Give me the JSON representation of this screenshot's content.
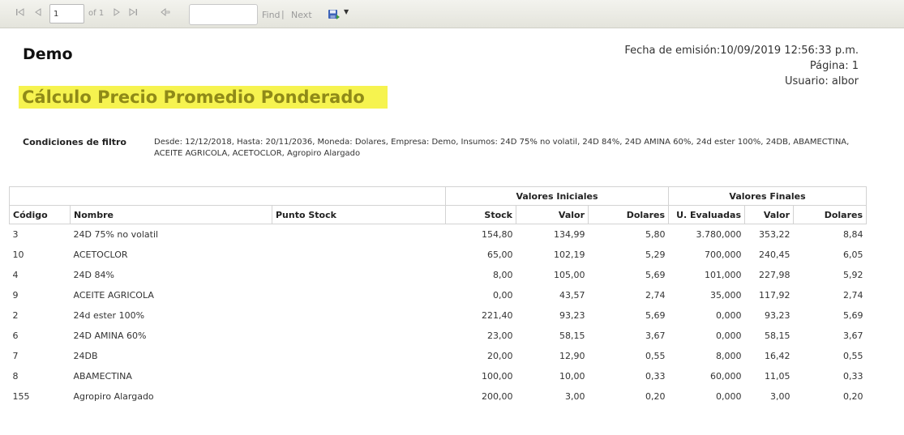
{
  "toolbar": {
    "page_value": "1",
    "of_label": "of 1",
    "find_label": "Find",
    "find_separator": "|",
    "next_label": "Next",
    "icons": [
      "first-page-icon",
      "prev-page-icon",
      "next-page-icon",
      "last-page-icon",
      "back-icon",
      "export-save-icon",
      "dropdown-arrow-icon"
    ]
  },
  "header": {
    "company": "Demo",
    "issue_date": "Fecha de emisión:10/09/2019 12:56:33 p.m.",
    "page": "Página: 1",
    "user": "Usuario: albor",
    "report_title": "Cálculo Precio Promedio Ponderado"
  },
  "filters": {
    "label": "Condiciones de filtro",
    "text": "Desde: 12/12/2018, Hasta: 20/11/2036, Moneda: Dolares, Empresa: Demo, Insumos: 24D 75% no volatil, 24D 84%, 24D AMINA 60%, 24d ester 100%, 24DB, ABAMECTINA, ACEITE AGRICOLA, ACETOCLOR, Agropiro Alargado"
  },
  "table": {
    "group_initial": "Valores Iniciales",
    "group_final": "Valores Finales",
    "columns": [
      "Código",
      "Nombre",
      "Punto Stock",
      "Stock",
      "Valor",
      "Dolares",
      "U. Evaluadas",
      "Valor",
      "Dolares"
    ],
    "rows": [
      [
        "3",
        "24D 75% no volatil",
        "",
        "154,80",
        "134,99",
        "5,80",
        "3.780,000",
        "353,22",
        "8,84"
      ],
      [
        "10",
        "ACETOCLOR",
        "",
        "65,00",
        "102,19",
        "5,29",
        "700,000",
        "240,45",
        "6,05"
      ],
      [
        "4",
        "24D 84%",
        "",
        "8,00",
        "105,00",
        "5,69",
        "101,000",
        "227,98",
        "5,92"
      ],
      [
        "9",
        "ACEITE AGRICOLA",
        "",
        "0,00",
        "43,57",
        "2,74",
        "35,000",
        "117,92",
        "2,74"
      ],
      [
        "2",
        "24d ester 100%",
        "",
        "221,40",
        "93,23",
        "5,69",
        "0,000",
        "93,23",
        "5,69"
      ],
      [
        "6",
        "24D AMINA 60%",
        "",
        "23,00",
        "58,15",
        "3,67",
        "0,000",
        "58,15",
        "3,67"
      ],
      [
        "7",
        "24DB",
        "",
        "20,00",
        "12,90",
        "0,55",
        "8,000",
        "16,42",
        "0,55"
      ],
      [
        "8",
        "ABAMECTINA",
        "",
        "100,00",
        "10,00",
        "0,33",
        "60,000",
        "11,05",
        "0,33"
      ],
      [
        "155",
        "Agropiro Alargado",
        "",
        "200,00",
        "3,00",
        "0,20",
        "0,000",
        "3,00",
        "0,20"
      ]
    ]
  },
  "colors": {
    "title_highlight": "#f6f34f",
    "title_text": "#8f8a18"
  }
}
